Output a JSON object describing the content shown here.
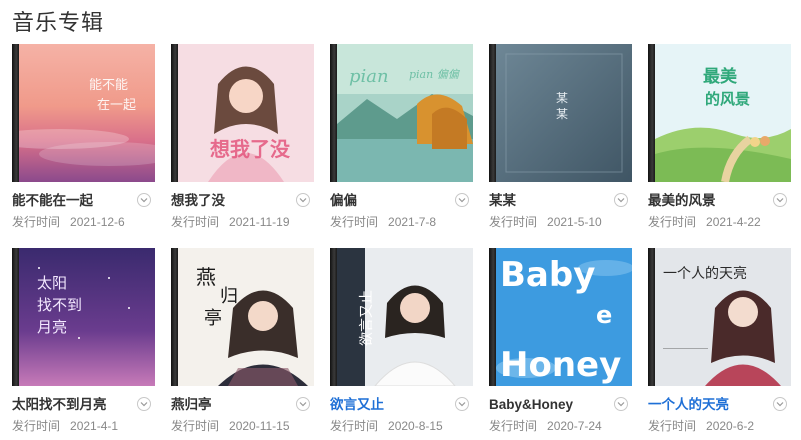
{
  "section": {
    "title": "音乐专辑"
  },
  "release_label": "发行时间",
  "albums": [
    {
      "name": "能不能在一起",
      "date": "2021-12-6",
      "active": false,
      "cover_text": "能不能在一起",
      "cover_theme": "sunset"
    },
    {
      "name": "想我了没",
      "date": "2021-11-19",
      "active": false,
      "cover_text": "想我了没",
      "cover_theme": "pink"
    },
    {
      "name": "偏偏",
      "date": "2021-7-8",
      "active": false,
      "cover_text": "pian pian 偏偏",
      "cover_theme": "lake"
    },
    {
      "name": "某某",
      "date": "2021-5-10",
      "active": false,
      "cover_text": "某某",
      "cover_theme": "slate"
    },
    {
      "name": "最美的风景",
      "date": "2021-4-22",
      "active": false,
      "cover_text": "最美的风景",
      "cover_theme": "meadow"
    },
    {
      "name": "太阳找不到月亮",
      "date": "2021-4-1",
      "active": false,
      "cover_text": "太阳找不到月亮",
      "cover_theme": "night"
    },
    {
      "name": "燕归亭",
      "date": "2020-11-15",
      "active": false,
      "cover_text": "燕归亭",
      "cover_theme": "ink"
    },
    {
      "name": "欲言又止",
      "date": "2020-8-15",
      "active": true,
      "cover_text": "欲言又止",
      "cover_theme": "grey"
    },
    {
      "name": "Baby&Honey",
      "date": "2020-7-24",
      "active": false,
      "cover_text": "Baby Honey",
      "cover_theme": "sky"
    },
    {
      "name": "一个人的天亮",
      "date": "2020-6-2",
      "active": true,
      "cover_text": "一个人的天亮",
      "cover_theme": "mist"
    }
  ],
  "colors": {
    "active_link": "#1e6fd6",
    "date_grey": "#888888",
    "title": "#333333"
  },
  "icons": {
    "more": "chevron-down-icon"
  }
}
